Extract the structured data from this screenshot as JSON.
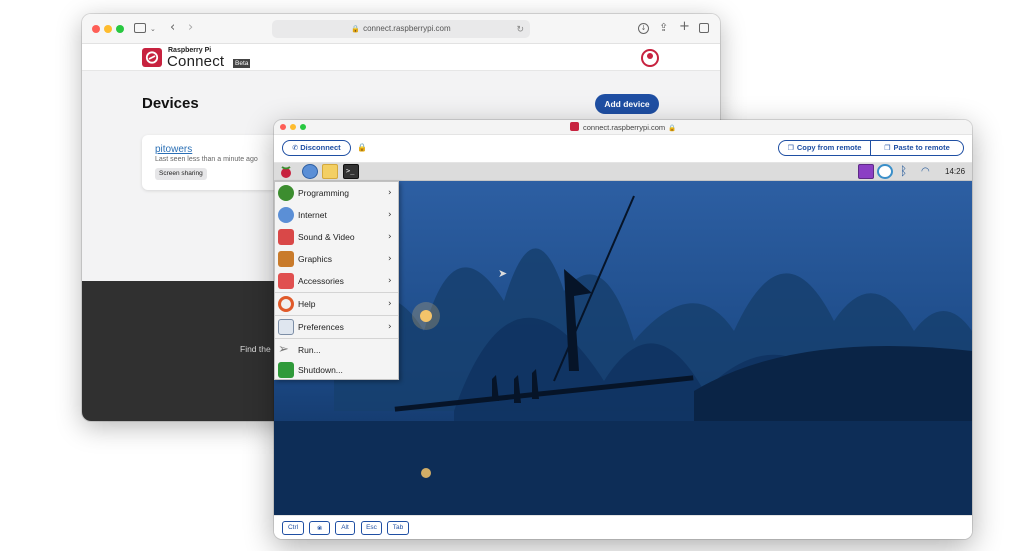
{
  "back_window": {
    "url": "connect.raspberrypi.com",
    "logo": {
      "small": "Raspberry Pi",
      "big": "Connect",
      "beta": "Beta"
    },
    "page_title": "Devices",
    "add_device_label": "Add device",
    "device": {
      "name": "pitowers",
      "last_seen": "Last seen less than a minute ago",
      "badge": "Screen sharing"
    },
    "footer_text": "Find the"
  },
  "front_window": {
    "title": "connect.raspberrypi.com",
    "disconnect_label": "Disconnect",
    "copy_label": "Copy from remote",
    "paste_label": "Paste to remote",
    "clock": "14:26",
    "menu": {
      "items": [
        {
          "label": "Programming",
          "icon": "programming-icon",
          "submenu": true
        },
        {
          "label": "Internet",
          "icon": "internet-icon",
          "submenu": true
        },
        {
          "label": "Sound & Video",
          "icon": "sound-video-icon",
          "submenu": true
        },
        {
          "label": "Graphics",
          "icon": "graphics-icon",
          "submenu": true
        },
        {
          "label": "Accessories",
          "icon": "accessories-icon",
          "submenu": true
        },
        {
          "label": "Help",
          "icon": "help-icon",
          "submenu": true
        },
        {
          "label": "Preferences",
          "icon": "preferences-icon",
          "submenu": true
        },
        {
          "label": "Run...",
          "icon": "run-icon",
          "submenu": false
        },
        {
          "label": "Shutdown...",
          "icon": "shutdown-icon",
          "submenu": false
        }
      ]
    },
    "keys": [
      "Ctrl",
      "Alt",
      "Esc",
      "Tab"
    ]
  },
  "colors": {
    "accent": "#1f4fa3",
    "brand": "#c7223f",
    "footer": "#303030",
    "wallpaper": "#1c4a86"
  }
}
